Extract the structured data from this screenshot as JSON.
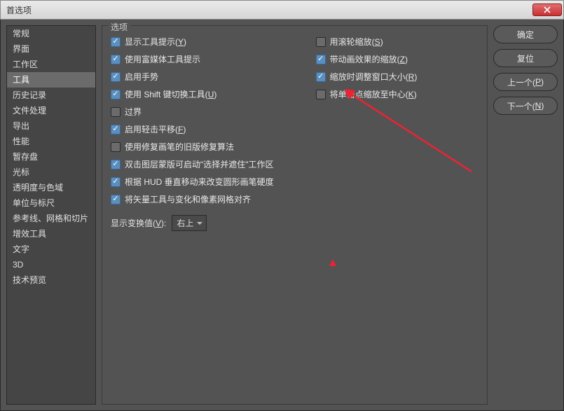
{
  "window": {
    "title": "首选项"
  },
  "sidebar": {
    "items": [
      {
        "label": "常规"
      },
      {
        "label": "界面"
      },
      {
        "label": "工作区"
      },
      {
        "label": "工具"
      },
      {
        "label": "历史记录"
      },
      {
        "label": "文件处理"
      },
      {
        "label": "导出"
      },
      {
        "label": "性能"
      },
      {
        "label": "暂存盘"
      },
      {
        "label": "光标"
      },
      {
        "label": "透明度与色域"
      },
      {
        "label": "单位与标尺"
      },
      {
        "label": "参考线、网格和切片"
      },
      {
        "label": "增效工具"
      },
      {
        "label": "文字"
      },
      {
        "label": "3D"
      },
      {
        "label": "技术预览"
      }
    ],
    "selectedIndex": 3
  },
  "panel": {
    "title": "选项",
    "left": [
      {
        "checked": true,
        "pre": "显示工具提示(",
        "u": "Y",
        "post": ")"
      },
      {
        "checked": true,
        "pre": "使用富媒体工具提示",
        "u": "",
        "post": ""
      },
      {
        "checked": true,
        "pre": "启用手势",
        "u": "",
        "post": ""
      },
      {
        "checked": true,
        "pre": "使用 Shift 键切换工具(",
        "u": "U",
        "post": ")"
      },
      {
        "checked": false,
        "pre": "过界",
        "u": "",
        "post": ""
      },
      {
        "checked": true,
        "pre": "启用轻击平移(",
        "u": "F",
        "post": ")"
      },
      {
        "checked": false,
        "pre": "使用修复画笔的旧版修复算法",
        "u": "",
        "post": ""
      },
      {
        "checked": true,
        "pre": "双击图层蒙版可启动\"选择并遮住\"工作区",
        "u": "",
        "post": ""
      },
      {
        "checked": true,
        "pre": "根据 HUD 垂直移动来改变圆形画笔硬度",
        "u": "",
        "post": ""
      },
      {
        "checked": true,
        "pre": "将矢量工具与变化和像素网格对齐",
        "u": "",
        "post": ""
      }
    ],
    "right": [
      {
        "checked": false,
        "pre": "用滚轮缩放(",
        "u": "S",
        "post": ")"
      },
      {
        "checked": true,
        "pre": "带动画效果的缩放(",
        "u": "Z",
        "post": ")"
      },
      {
        "checked": true,
        "pre": "缩放时调整窗口大小(",
        "u": "R",
        "post": ")"
      },
      {
        "checked": false,
        "pre": "将单击点缩放至中心(",
        "u": "K",
        "post": ")"
      }
    ],
    "transform": {
      "labelPre": "显示变换值(",
      "u": "V",
      "labelPost": "):",
      "value": "右上"
    }
  },
  "buttons": {
    "ok": "确定",
    "reset": "复位",
    "prev_pre": "上一个(",
    "prev_u": "P",
    "prev_post": ")",
    "next_pre": "下一个(",
    "next_u": "N",
    "next_post": ")"
  }
}
